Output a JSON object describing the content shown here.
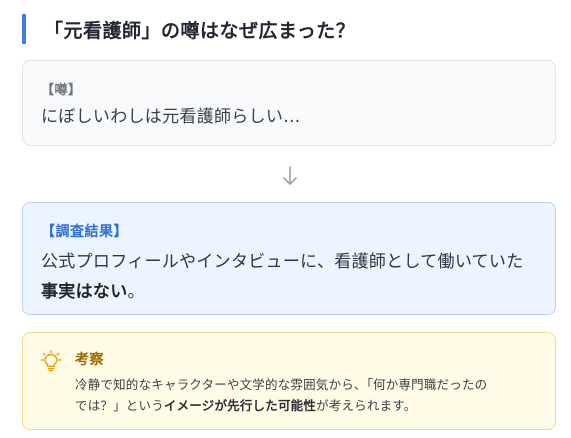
{
  "heading": {
    "title": "「元看護師」の噂はなぜ広まった？"
  },
  "rumor": {
    "label": "【噂】",
    "text": "にぼしいわしは元看護師らしい…"
  },
  "investigation": {
    "label": "【調査結果】",
    "text_before": "公式プロフィールやインタビューに、看護師として働いていた",
    "text_emphasis": "事実はない",
    "text_after": "。"
  },
  "consideration": {
    "label": "考察",
    "line1": "冷静で知的なキャラクターや文学的な雰囲気から、「何か専門職だったの",
    "line2_prefix": "では？」という",
    "line2_emphasis": "イメージが先行した可能性",
    "line2_suffix": "が考えられます。"
  },
  "icons": {
    "arrow": "arrow-down-icon",
    "bulb": "lightbulb-icon"
  },
  "colors": {
    "accent_blue": "#3b7de0",
    "investigation_bg": "#eef4fd",
    "consideration_bg": "#fffbe6",
    "consideration_label": "#9a6a00"
  }
}
